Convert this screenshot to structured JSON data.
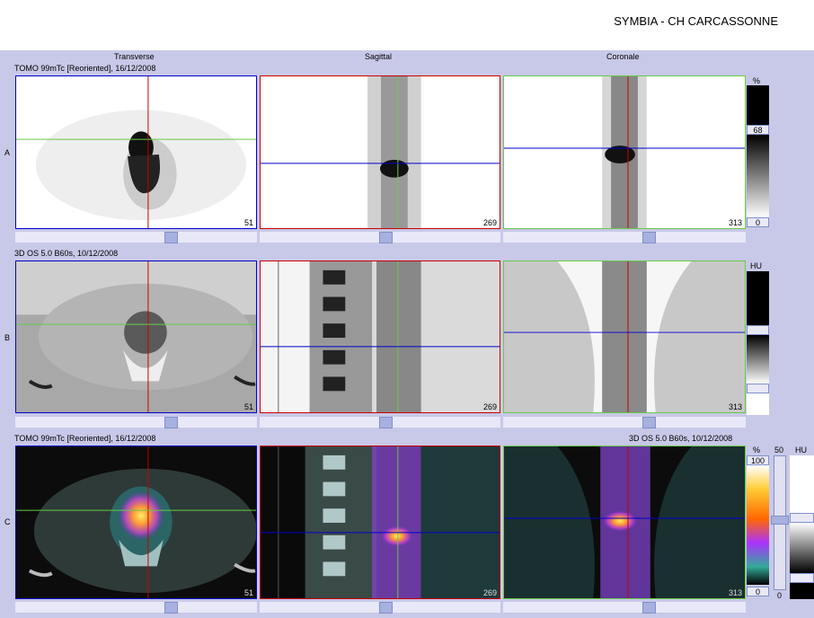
{
  "header": {
    "title": "SYMBIA - CH CARCASSONNE"
  },
  "columns": {
    "transverse": "Transverse",
    "sagittal": "Sagittal",
    "coronal": "Coronale"
  },
  "rows": {
    "a": {
      "letter": "A",
      "series": "TOMO 99mTc [Reoriented], 16/12/2008"
    },
    "b": {
      "letter": "B",
      "series": "3D  OS  5.0  B60s, 10/12/2008"
    },
    "c": {
      "letter": "C",
      "series_left": "TOMO 99mTc [Reoriented], 16/12/2008",
      "series_right": "3D  OS  5.0  B60s, 10/12/2008"
    }
  },
  "slices": {
    "transverse": "51",
    "sagittal": "269",
    "coronal": "313"
  },
  "colorbars": {
    "a": {
      "unit": "%",
      "max": "68",
      "min": "0"
    },
    "b": {
      "unit": "HU"
    },
    "c": {
      "unit": "%",
      "max": "100",
      "min": "0",
      "blend": "50",
      "ct_unit": "HU",
      "blend_min": "0"
    }
  },
  "colors": {
    "accent": "#c8c8e8",
    "transverse_border": "#0000cc",
    "sagittal_border": "#cc0000",
    "coronal_border": "#66cc44"
  }
}
